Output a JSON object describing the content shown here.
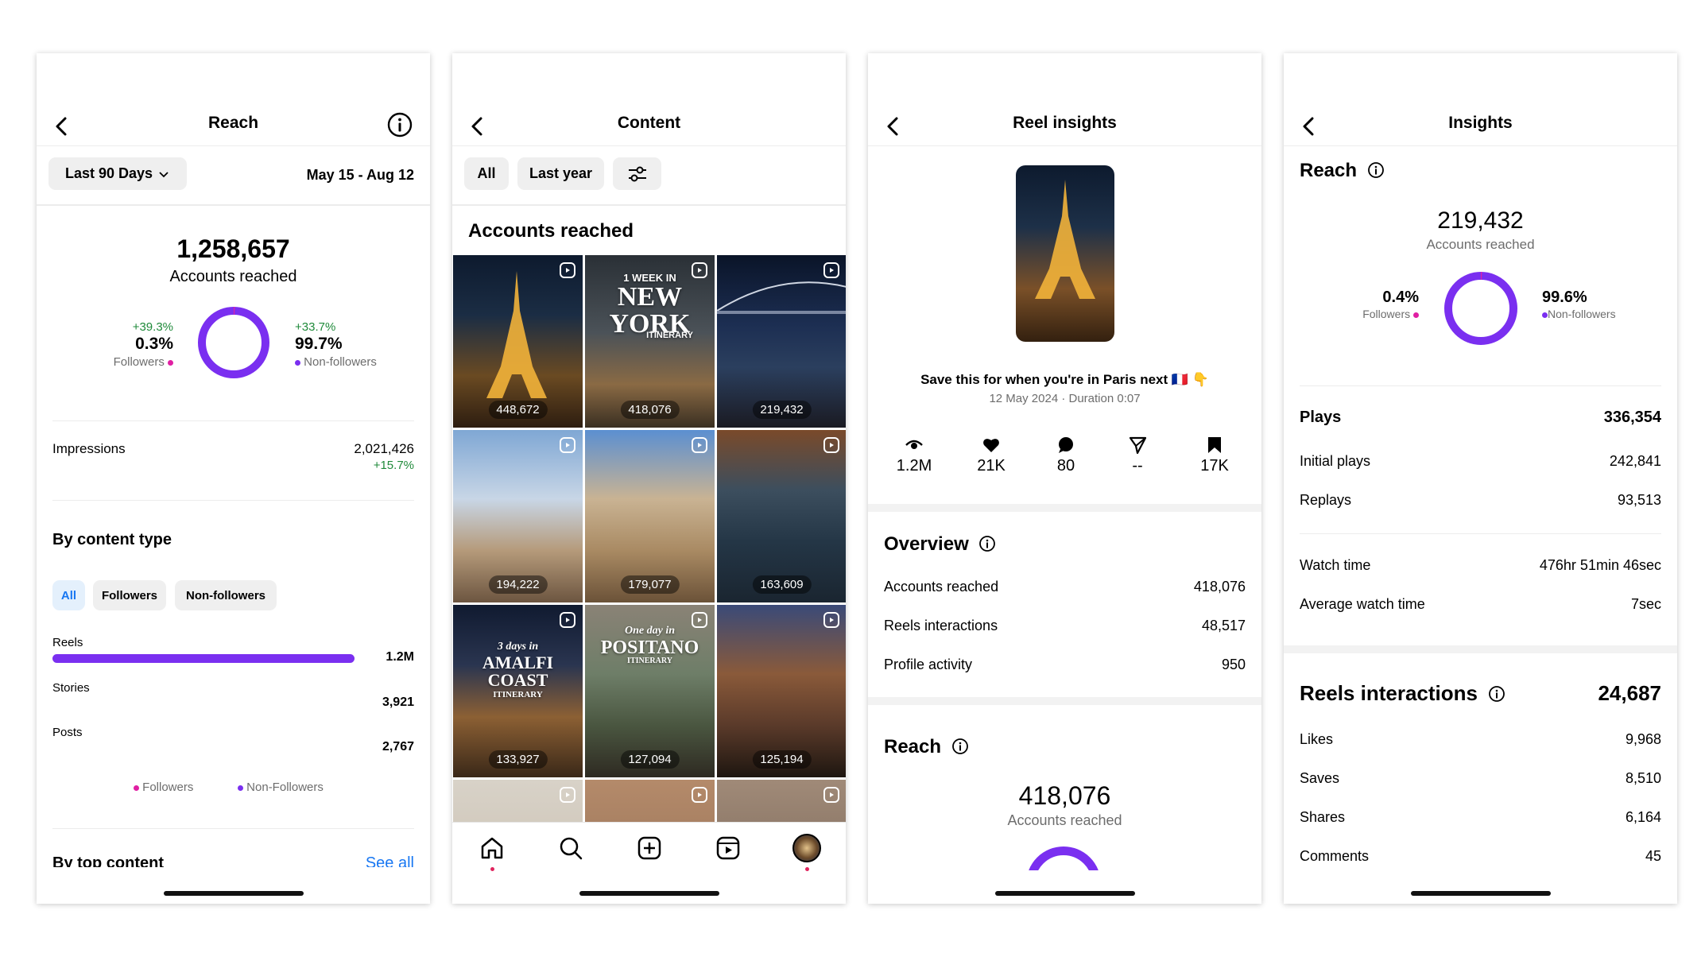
{
  "colors": {
    "accent": "#7a2ff0",
    "pink": "#e01fa3",
    "green": "#1f8a3a",
    "link": "#1877f2"
  },
  "reach": {
    "title": "Reach",
    "range_label": "Last 90 Days",
    "date_range": "May 15 - Aug 12",
    "total": "1,258,657",
    "total_label": "Accounts reached",
    "followers": {
      "change": "+39.3%",
      "pct": "0.3%",
      "label": "Followers"
    },
    "non_followers": {
      "change": "+33.7%",
      "pct": "99.7%",
      "label": "Non-followers"
    },
    "impressions": {
      "label": "Impressions",
      "value": "2,021,426",
      "change": "+15.7%"
    },
    "by_content_type": {
      "heading": "By content type",
      "filters": [
        "All",
        "Followers",
        "Non-followers"
      ],
      "selected_filter": "All",
      "rows": [
        {
          "label": "Reels",
          "value": "1.2M",
          "bar_fraction": 1.0
        },
        {
          "label": "Stories",
          "value": "3,921",
          "bar_fraction": 0
        },
        {
          "label": "Posts",
          "value": "2,767",
          "bar_fraction": 0
        }
      ],
      "legend": [
        "Followers",
        "Non-Followers"
      ]
    },
    "top_content": {
      "heading": "By top content",
      "link": "See all"
    }
  },
  "content": {
    "title": "Content",
    "filters": [
      "All",
      "Last year"
    ],
    "heading": "Accounts reached",
    "tiles": [
      {
        "count": "448,672",
        "overlay": ""
      },
      {
        "count": "418,076",
        "overlay": "1 WEEK IN NEW YORK ITINERARY"
      },
      {
        "count": "219,432",
        "overlay": ""
      },
      {
        "count": "194,222",
        "overlay": ""
      },
      {
        "count": "179,077",
        "overlay": ""
      },
      {
        "count": "163,609",
        "overlay": ""
      },
      {
        "count": "133,927",
        "overlay": "3 days in AMALFI COAST ITINERARY"
      },
      {
        "count": "127,094",
        "overlay": "One day in POSITANO ITINERARY"
      },
      {
        "count": "125,194",
        "overlay": ""
      }
    ],
    "tabs": [
      "home-icon",
      "search-icon",
      "create-icon",
      "reels-icon",
      "profile-avatar"
    ]
  },
  "reel": {
    "title": "Reel insights",
    "caption": "Save this for when you're in Paris next 🇫🇷 👇",
    "meta": "12 May 2024 · Duration 0:07",
    "stats": [
      {
        "icon": "views-icon",
        "value": "1.2M"
      },
      {
        "icon": "heart-icon",
        "value": "21K"
      },
      {
        "icon": "comment-icon",
        "value": "80"
      },
      {
        "icon": "share-icon",
        "value": "--"
      },
      {
        "icon": "bookmark-icon",
        "value": "17K"
      }
    ],
    "overview": {
      "heading": "Overview",
      "rows": [
        {
          "label": "Accounts reached",
          "value": "418,076"
        },
        {
          "label": "Reels interactions",
          "value": "48,517"
        },
        {
          "label": "Profile activity",
          "value": "950"
        }
      ]
    },
    "reach": {
      "heading": "Reach",
      "total": "418,076",
      "label": "Accounts reached"
    }
  },
  "insights": {
    "title": "Insights",
    "reach": {
      "heading": "Reach",
      "total": "219,432",
      "label": "Accounts reached",
      "followers": {
        "pct": "0.4%",
        "label": "Followers"
      },
      "non_followers": {
        "pct": "99.6%",
        "label": "Non-followers"
      }
    },
    "plays": {
      "label": "Plays",
      "value": "336,354",
      "rows": [
        {
          "label": "Initial plays",
          "value": "242,841"
        },
        {
          "label": "Replays",
          "value": "93,513"
        }
      ]
    },
    "watch": [
      {
        "label": "Watch time",
        "value": "476hr 51min 46sec"
      },
      {
        "label": "Average watch time",
        "value": "7sec"
      }
    ],
    "interactions": {
      "heading": "Reels interactions",
      "value": "24,687",
      "rows": [
        {
          "label": "Likes",
          "value": "9,968"
        },
        {
          "label": "Saves",
          "value": "8,510"
        },
        {
          "label": "Shares",
          "value": "6,164"
        },
        {
          "label": "Comments",
          "value": "45"
        }
      ]
    }
  }
}
